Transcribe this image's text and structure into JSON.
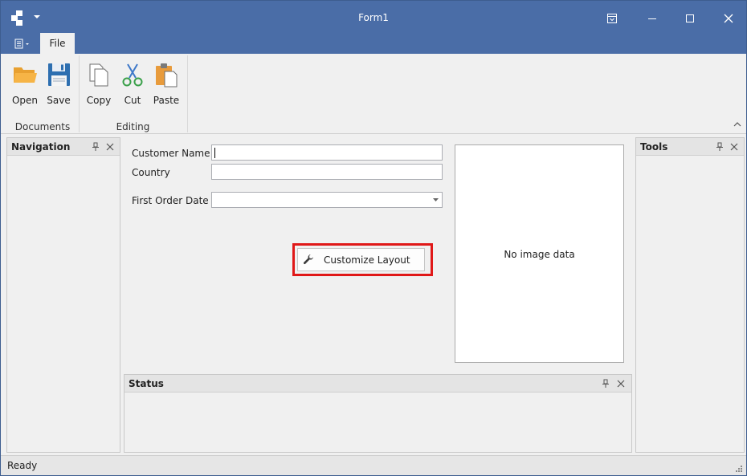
{
  "window": {
    "title": "Form1",
    "accent_color": "#4a6da7"
  },
  "icons": {
    "app": "app-logo-icon",
    "restore_ribbon": "ribbon-display-options-icon",
    "maximize": "maximize-icon",
    "close": "close-icon"
  },
  "ribbon": {
    "tabs": [
      {
        "label": "File"
      }
    ],
    "groups": [
      {
        "label": "Documents",
        "buttons": [
          {
            "label": "Open",
            "icon": "folder-open-icon"
          },
          {
            "label": "Save",
            "icon": "floppy-save-icon"
          }
        ]
      },
      {
        "label": "Editing",
        "buttons": [
          {
            "label": "Copy",
            "icon": "copy-icon"
          },
          {
            "label": "Cut",
            "icon": "scissors-icon"
          },
          {
            "label": "Paste",
            "icon": "clipboard-paste-icon"
          }
        ]
      }
    ]
  },
  "panels": {
    "navigation": {
      "title": "Navigation"
    },
    "tools": {
      "title": "Tools"
    },
    "status": {
      "title": "Status"
    }
  },
  "form": {
    "customer_name": {
      "label": "Customer Name",
      "value": ""
    },
    "country": {
      "label": "Country",
      "value": ""
    },
    "first_order_date": {
      "label": "First Order Date",
      "value": ""
    },
    "customize_button": {
      "label": "Customize Layout",
      "icon": "wrench-icon"
    },
    "image_placeholder": "No image data"
  },
  "highlight_color": "#e01818",
  "statusbar": {
    "text": "Ready"
  }
}
